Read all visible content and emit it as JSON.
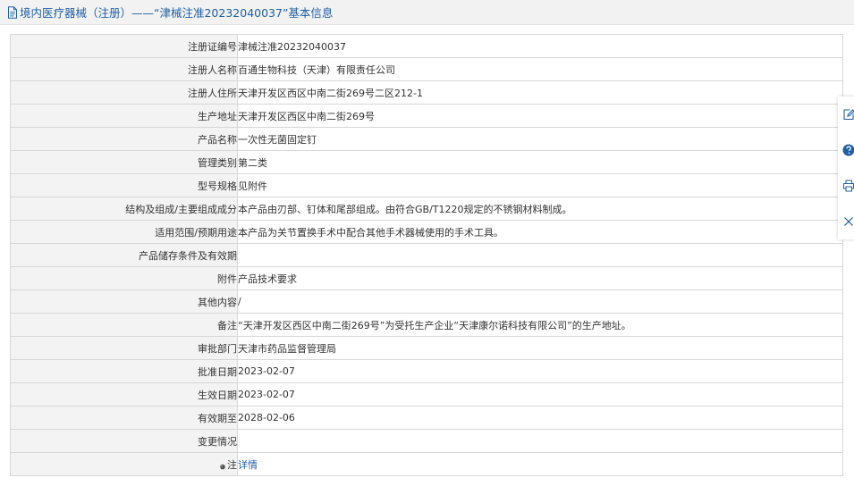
{
  "header": {
    "title": "境内医疗器械（注册）——“津械注准20232040037”基本信息",
    "icon": "document-icon"
  },
  "rows": [
    {
      "label": "注册证编号",
      "value": "津械注准20232040037"
    },
    {
      "label": "注册人名称",
      "value": "百通生物科技（天津）有限责任公司"
    },
    {
      "label": "注册人住所",
      "value": "天津开发区西区中南二街269号二区212-1"
    },
    {
      "label": "生产地址",
      "value": "天津开发区西区中南二街269号"
    },
    {
      "label": "产品名称",
      "value": "一次性无菌固定钉"
    },
    {
      "label": "管理类别",
      "value": "第二类"
    },
    {
      "label": "型号规格",
      "value": "见附件"
    },
    {
      "label": "结构及组成/主要组成成分",
      "value": "本产品由刃部、钉体和尾部组成。由符合GB/T1220规定的不锈钢材料制成。"
    },
    {
      "label": "适用范围/预期用途",
      "value": "本产品为关节置换手术中配合其他手术器械使用的手术工具。"
    },
    {
      "label": "产品储存条件及有效期",
      "value": ""
    },
    {
      "label": "附件",
      "value": "产品技术要求"
    },
    {
      "label": "其他内容",
      "value": "/"
    },
    {
      "label": "备注",
      "value": "“天津开发区西区中南二街269号”为受托生产企业“天津康尔诺科技有限公司”的生产地址。"
    },
    {
      "label": "审批部门",
      "value": "天津市药品监督管理局"
    },
    {
      "label": "批准日期",
      "value": "2023-02-07"
    },
    {
      "label": "生效日期",
      "value": "2023-02-07"
    },
    {
      "label": "有效期至",
      "value": "2028-02-06"
    },
    {
      "label": "变更情况",
      "value": ""
    }
  ],
  "note_row": {
    "label": "注",
    "link_text": "详情",
    "icon": "pin-icon"
  },
  "toolbar": {
    "items": [
      "edit-icon",
      "help-icon",
      "print-icon",
      "close-icon"
    ]
  },
  "colors": {
    "link": "#1f5fa6",
    "label_bg": "#f3f3f3",
    "header_bg": "#f2f2f2",
    "border": "#d7d7d7",
    "help_icon": "#1f5fa6"
  }
}
